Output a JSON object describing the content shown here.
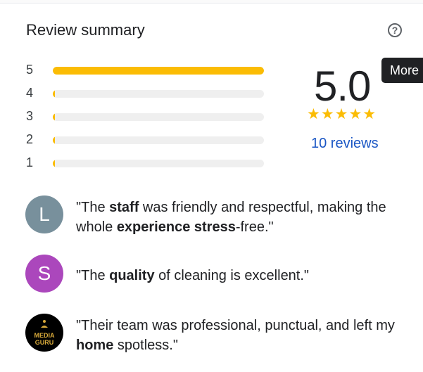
{
  "header": {
    "title": "Review summary",
    "help_icon": "help-circle-icon"
  },
  "rating_distribution": [
    {
      "stars": "5",
      "fraction": 1.0
    },
    {
      "stars": "4",
      "fraction": 0.0
    },
    {
      "stars": "3",
      "fraction": 0.0
    },
    {
      "stars": "2",
      "fraction": 0.0
    },
    {
      "stars": "1",
      "fraction": 0.0
    }
  ],
  "summary": {
    "score": "5.0",
    "stars": "★★★★★",
    "reviews_link": "10 reviews"
  },
  "tooltip": {
    "label": "More"
  },
  "snippets": [
    {
      "avatar_letter": "L",
      "avatar_color": "#78909c",
      "parts": [
        {
          "t": "\"The ",
          "b": false
        },
        {
          "t": "staff",
          "b": true
        },
        {
          "t": " was friendly and respectful, making the whole ",
          "b": false
        },
        {
          "t": "experience stress",
          "b": true
        },
        {
          "t": "-free.\"",
          "b": false
        }
      ]
    },
    {
      "avatar_letter": "S",
      "avatar_color": "#ab47bc",
      "parts": [
        {
          "t": "\"The ",
          "b": false
        },
        {
          "t": "quality",
          "b": true
        },
        {
          "t": " of cleaning is excellent.\"",
          "b": false
        }
      ]
    },
    {
      "avatar_logo_line1": "MEDIA",
      "avatar_logo_line2": "GURU",
      "avatar_color": "#000000",
      "parts": [
        {
          "t": "\"Their team was professional, punctual, and left my ",
          "b": false
        },
        {
          "t": "home",
          "b": true
        },
        {
          "t": " spotless.\"",
          "b": false
        }
      ]
    }
  ],
  "colors": {
    "accent_star": "#fbbc04",
    "link": "#1a56c4",
    "bar_track": "#efefef"
  }
}
